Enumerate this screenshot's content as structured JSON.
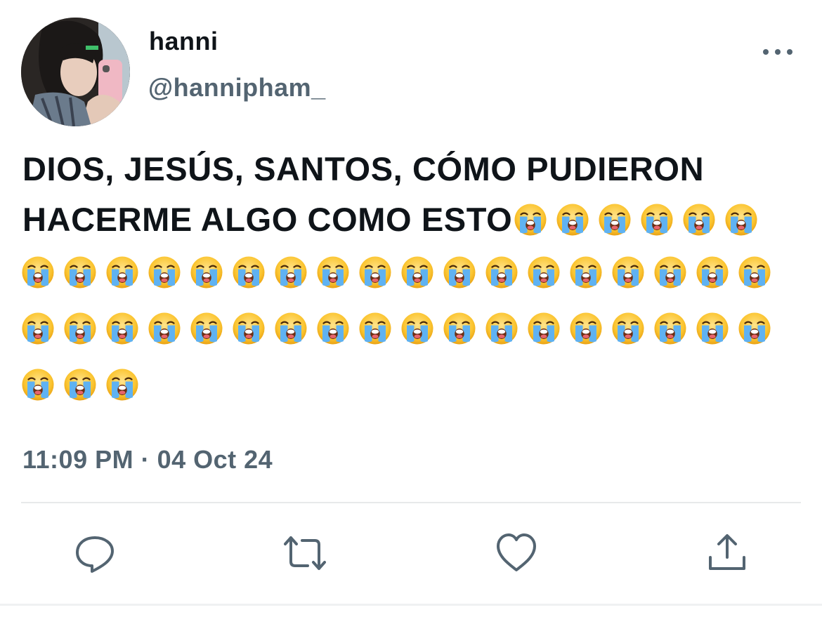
{
  "user": {
    "name": "hanni",
    "handle": "@hannipham_"
  },
  "tweet": {
    "text_line1": "DIOS, JESÚS, SANTOS, CÓMO PUDIERON",
    "text_line2": "HACERME ALGO COMO ESTO",
    "emoji": "loudly-crying-face",
    "emoji_count_line2": 6,
    "emoji_rows": [
      18,
      18,
      3
    ],
    "timestamp": "11:09 PM · 04 Oct 24"
  },
  "actions": [
    {
      "icon": "reply-icon"
    },
    {
      "icon": "retweet-icon"
    },
    {
      "icon": "like-icon"
    },
    {
      "icon": "share-icon"
    }
  ],
  "colors": {
    "text": "#0f1419",
    "secondary": "#536471",
    "divider": "#e7e9ea"
  }
}
